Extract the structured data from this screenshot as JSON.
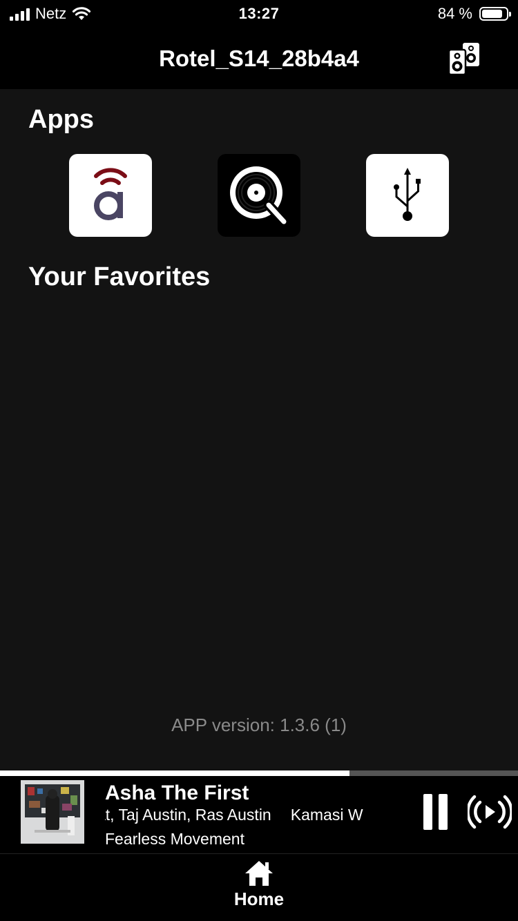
{
  "status_bar": {
    "carrier": "Netz",
    "time": "13:27",
    "battery_text": "84 %",
    "battery_level": 0.84
  },
  "header": {
    "title": "Rotel_S14_28b4a4",
    "speaker_icon": "speakers-icon"
  },
  "apps": {
    "title": "Apps",
    "items": [
      {
        "icon": "airable-icon"
      },
      {
        "icon": "qobuz-icon"
      },
      {
        "icon": "usb-icon"
      }
    ]
  },
  "favorites": {
    "title": "Your Favorites"
  },
  "version": "APP version: 1.3.6 (1)",
  "now_playing": {
    "title": "Asha The First",
    "artists": "Kamasi Washington, Thundercat, Taj Austin, Ras Austin",
    "artists_visible_lead": "at, Taj Austin, Ras Austin",
    "artists_visible_tail": "Kamasi W",
    "album": "Fearless Movement",
    "progress": 0.675,
    "pause_icon": "pause-icon",
    "cast_icon": "cast-icon"
  },
  "tabbar": {
    "home_label": "Home",
    "home_icon": "home-icon"
  },
  "colors": {
    "background": "#131313",
    "bars": "#000000",
    "accent_red": "#7b0d16",
    "airable_purple": "#4a4563",
    "version_text": "#8a8a8a"
  }
}
